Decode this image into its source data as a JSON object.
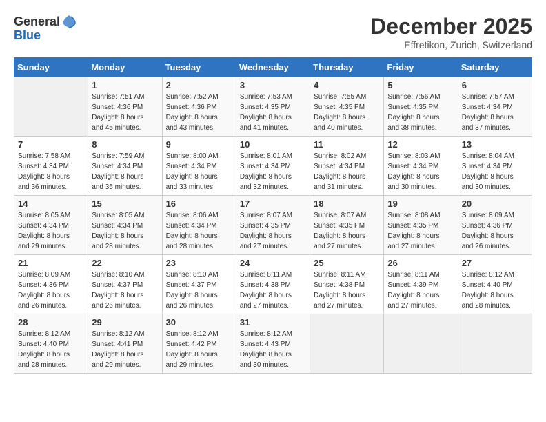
{
  "logo": {
    "general": "General",
    "blue": "Blue"
  },
  "title": "December 2025",
  "subtitle": "Effretikon, Zurich, Switzerland",
  "weekdays": [
    "Sunday",
    "Monday",
    "Tuesday",
    "Wednesday",
    "Thursday",
    "Friday",
    "Saturday"
  ],
  "weeks": [
    [
      {
        "day": "",
        "sunrise": "",
        "sunset": "",
        "daylight": ""
      },
      {
        "day": "1",
        "sunrise": "Sunrise: 7:51 AM",
        "sunset": "Sunset: 4:36 PM",
        "daylight": "Daylight: 8 hours and 45 minutes."
      },
      {
        "day": "2",
        "sunrise": "Sunrise: 7:52 AM",
        "sunset": "Sunset: 4:36 PM",
        "daylight": "Daylight: 8 hours and 43 minutes."
      },
      {
        "day": "3",
        "sunrise": "Sunrise: 7:53 AM",
        "sunset": "Sunset: 4:35 PM",
        "daylight": "Daylight: 8 hours and 41 minutes."
      },
      {
        "day": "4",
        "sunrise": "Sunrise: 7:55 AM",
        "sunset": "Sunset: 4:35 PM",
        "daylight": "Daylight: 8 hours and 40 minutes."
      },
      {
        "day": "5",
        "sunrise": "Sunrise: 7:56 AM",
        "sunset": "Sunset: 4:35 PM",
        "daylight": "Daylight: 8 hours and 38 minutes."
      },
      {
        "day": "6",
        "sunrise": "Sunrise: 7:57 AM",
        "sunset": "Sunset: 4:34 PM",
        "daylight": "Daylight: 8 hours and 37 minutes."
      }
    ],
    [
      {
        "day": "7",
        "sunrise": "Sunrise: 7:58 AM",
        "sunset": "Sunset: 4:34 PM",
        "daylight": "Daylight: 8 hours and 36 minutes."
      },
      {
        "day": "8",
        "sunrise": "Sunrise: 7:59 AM",
        "sunset": "Sunset: 4:34 PM",
        "daylight": "Daylight: 8 hours and 35 minutes."
      },
      {
        "day": "9",
        "sunrise": "Sunrise: 8:00 AM",
        "sunset": "Sunset: 4:34 PM",
        "daylight": "Daylight: 8 hours and 33 minutes."
      },
      {
        "day": "10",
        "sunrise": "Sunrise: 8:01 AM",
        "sunset": "Sunset: 4:34 PM",
        "daylight": "Daylight: 8 hours and 32 minutes."
      },
      {
        "day": "11",
        "sunrise": "Sunrise: 8:02 AM",
        "sunset": "Sunset: 4:34 PM",
        "daylight": "Daylight: 8 hours and 31 minutes."
      },
      {
        "day": "12",
        "sunrise": "Sunrise: 8:03 AM",
        "sunset": "Sunset: 4:34 PM",
        "daylight": "Daylight: 8 hours and 30 minutes."
      },
      {
        "day": "13",
        "sunrise": "Sunrise: 8:04 AM",
        "sunset": "Sunset: 4:34 PM",
        "daylight": "Daylight: 8 hours and 30 minutes."
      }
    ],
    [
      {
        "day": "14",
        "sunrise": "Sunrise: 8:05 AM",
        "sunset": "Sunset: 4:34 PM",
        "daylight": "Daylight: 8 hours and 29 minutes."
      },
      {
        "day": "15",
        "sunrise": "Sunrise: 8:05 AM",
        "sunset": "Sunset: 4:34 PM",
        "daylight": "Daylight: 8 hours and 28 minutes."
      },
      {
        "day": "16",
        "sunrise": "Sunrise: 8:06 AM",
        "sunset": "Sunset: 4:34 PM",
        "daylight": "Daylight: 8 hours and 28 minutes."
      },
      {
        "day": "17",
        "sunrise": "Sunrise: 8:07 AM",
        "sunset": "Sunset: 4:35 PM",
        "daylight": "Daylight: 8 hours and 27 minutes."
      },
      {
        "day": "18",
        "sunrise": "Sunrise: 8:07 AM",
        "sunset": "Sunset: 4:35 PM",
        "daylight": "Daylight: 8 hours and 27 minutes."
      },
      {
        "day": "19",
        "sunrise": "Sunrise: 8:08 AM",
        "sunset": "Sunset: 4:35 PM",
        "daylight": "Daylight: 8 hours and 27 minutes."
      },
      {
        "day": "20",
        "sunrise": "Sunrise: 8:09 AM",
        "sunset": "Sunset: 4:36 PM",
        "daylight": "Daylight: 8 hours and 26 minutes."
      }
    ],
    [
      {
        "day": "21",
        "sunrise": "Sunrise: 8:09 AM",
        "sunset": "Sunset: 4:36 PM",
        "daylight": "Daylight: 8 hours and 26 minutes."
      },
      {
        "day": "22",
        "sunrise": "Sunrise: 8:10 AM",
        "sunset": "Sunset: 4:37 PM",
        "daylight": "Daylight: 8 hours and 26 minutes."
      },
      {
        "day": "23",
        "sunrise": "Sunrise: 8:10 AM",
        "sunset": "Sunset: 4:37 PM",
        "daylight": "Daylight: 8 hours and 26 minutes."
      },
      {
        "day": "24",
        "sunrise": "Sunrise: 8:11 AM",
        "sunset": "Sunset: 4:38 PM",
        "daylight": "Daylight: 8 hours and 27 minutes."
      },
      {
        "day": "25",
        "sunrise": "Sunrise: 8:11 AM",
        "sunset": "Sunset: 4:38 PM",
        "daylight": "Daylight: 8 hours and 27 minutes."
      },
      {
        "day": "26",
        "sunrise": "Sunrise: 8:11 AM",
        "sunset": "Sunset: 4:39 PM",
        "daylight": "Daylight: 8 hours and 27 minutes."
      },
      {
        "day": "27",
        "sunrise": "Sunrise: 8:12 AM",
        "sunset": "Sunset: 4:40 PM",
        "daylight": "Daylight: 8 hours and 28 minutes."
      }
    ],
    [
      {
        "day": "28",
        "sunrise": "Sunrise: 8:12 AM",
        "sunset": "Sunset: 4:40 PM",
        "daylight": "Daylight: 8 hours and 28 minutes."
      },
      {
        "day": "29",
        "sunrise": "Sunrise: 8:12 AM",
        "sunset": "Sunset: 4:41 PM",
        "daylight": "Daylight: 8 hours and 29 minutes."
      },
      {
        "day": "30",
        "sunrise": "Sunrise: 8:12 AM",
        "sunset": "Sunset: 4:42 PM",
        "daylight": "Daylight: 8 hours and 29 minutes."
      },
      {
        "day": "31",
        "sunrise": "Sunrise: 8:12 AM",
        "sunset": "Sunset: 4:43 PM",
        "daylight": "Daylight: 8 hours and 30 minutes."
      },
      {
        "day": "",
        "sunrise": "",
        "sunset": "",
        "daylight": ""
      },
      {
        "day": "",
        "sunrise": "",
        "sunset": "",
        "daylight": ""
      },
      {
        "day": "",
        "sunrise": "",
        "sunset": "",
        "daylight": ""
      }
    ]
  ]
}
